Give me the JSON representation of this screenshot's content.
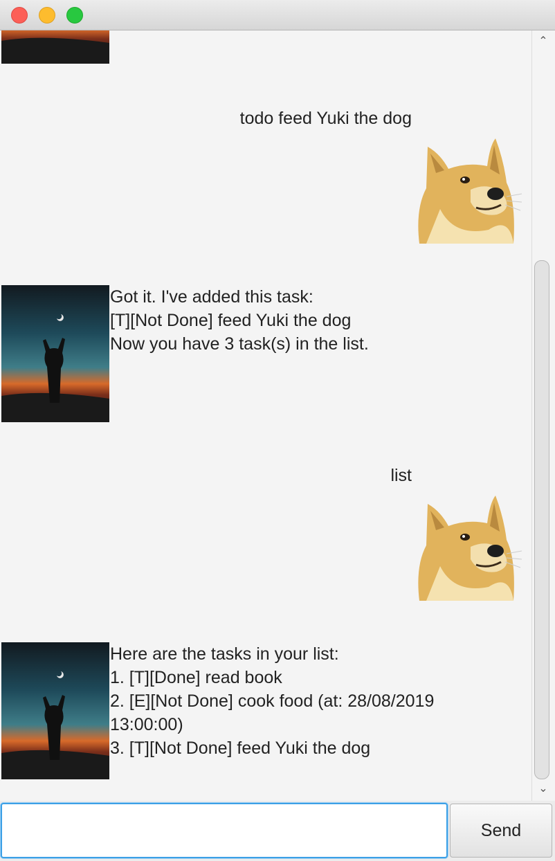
{
  "window": {
    "controls": [
      "close",
      "minimize",
      "maximize"
    ]
  },
  "messages": {
    "user_1": "todo feed Yuki the dog",
    "bot_1": "Got it. I've added this task:\n[T][Not Done] feed Yuki the dog\nNow you have 3 task(s) in the list.",
    "user_2": "list",
    "bot_2": "Here are the tasks in your list:\n1. [T][Done] read book\n2. [E][Not Done] cook food (at: 28/08/2019\n13:00:00)\n3. [T][Not Done] feed Yuki the dog"
  },
  "input": {
    "placeholder": "",
    "value": ""
  },
  "send_button": {
    "label": "Send"
  },
  "scrollbar": {
    "position": 0.95
  }
}
